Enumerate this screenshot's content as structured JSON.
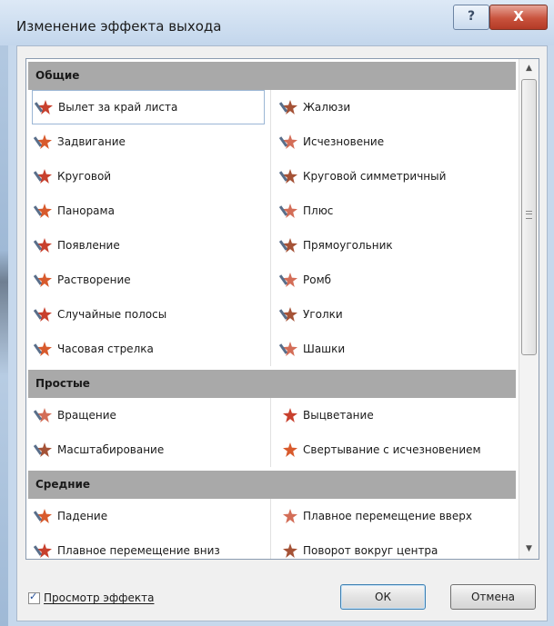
{
  "window": {
    "title": "Изменение эффекта выхода",
    "help_label": "?",
    "close_label": "X"
  },
  "groups": [
    {
      "name": "Общие",
      "items": [
        {
          "label": "Вылет за край листа",
          "icon": "flyout-star-icon",
          "selected": true
        },
        {
          "label": "Жалюзи",
          "icon": "blinds-star-icon"
        },
        {
          "label": "Задвигание",
          "icon": "crawl-star-icon"
        },
        {
          "label": "Исчезновение",
          "icon": "disappear-star-icon"
        },
        {
          "label": "Круговой",
          "icon": "circle-star-icon"
        },
        {
          "label": "Круговой симметричный",
          "icon": "diamond-star-icon"
        },
        {
          "label": "Панорама",
          "icon": "peek-star-icon"
        },
        {
          "label": "Плюс",
          "icon": "plus-star-icon"
        },
        {
          "label": "Появление",
          "icon": "appear-star-icon"
        },
        {
          "label": "Прямоугольник",
          "icon": "box-star-icon"
        },
        {
          "label": "Растворение",
          "icon": "dissolve-star-icon"
        },
        {
          "label": "Ромб",
          "icon": "rhombus-star-icon"
        },
        {
          "label": "Случайные полосы",
          "icon": "random-bars-star-icon"
        },
        {
          "label": "Уголки",
          "icon": "corners-star-icon"
        },
        {
          "label": "Часовая стрелка",
          "icon": "wheel-star-icon"
        },
        {
          "label": "Шашки",
          "icon": "checkerboard-star-icon"
        }
      ]
    },
    {
      "name": "Простые",
      "items": [
        {
          "label": "Вращение",
          "icon": "spin-star-icon"
        },
        {
          "label": "Выцветание",
          "icon": "fade-star-icon"
        },
        {
          "label": "Масштабирование",
          "icon": "zoom-star-icon"
        },
        {
          "label": "Свертывание с исчезновением",
          "icon": "collapse-star-icon"
        }
      ]
    },
    {
      "name": "Средние",
      "items": [
        {
          "label": "Падение",
          "icon": "fall-star-icon"
        },
        {
          "label": "Плавное перемещение вверх",
          "icon": "float-up-star-icon"
        },
        {
          "label": "Плавное перемещение вниз",
          "icon": "float-down-star-icon"
        },
        {
          "label": "Поворот вокруг центра",
          "icon": "pivot-star-icon"
        }
      ]
    }
  ],
  "footer": {
    "preview_label": "Просмотр эффекта",
    "preview_checked": true,
    "ok_label": "ОК",
    "cancel_label": "Отмена"
  },
  "colors": {
    "group_header": "#a9a9a9",
    "selection_border": "#9bb6d5"
  }
}
